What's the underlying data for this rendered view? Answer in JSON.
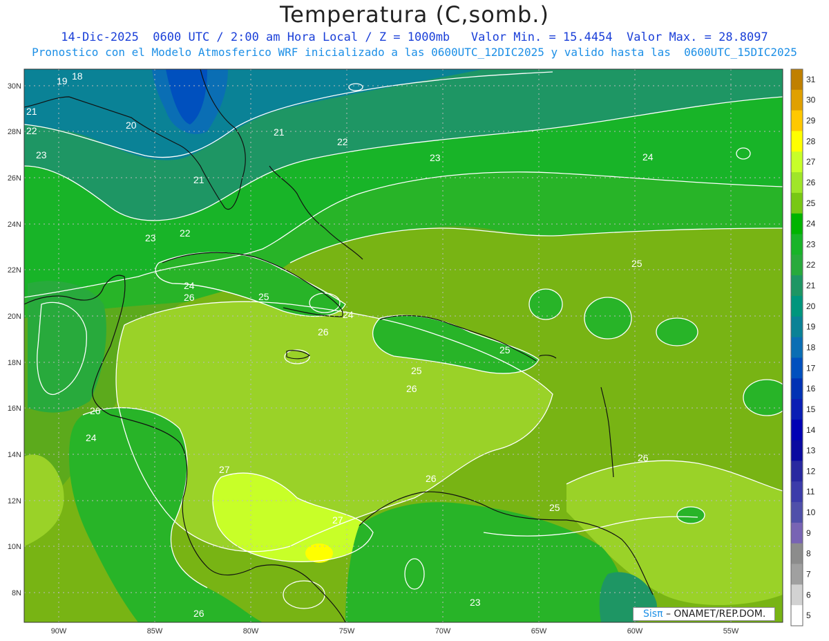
{
  "title": "Temperatura (C,somb.)",
  "subtitle_line1": "14-Dic-2025  0600 UTC / 2:00 am Hora Local / Z = 1000mb   Valor Min. = 15.4454  Valor Max. = 28.8097",
  "subtitle_line2": "Pronostico con el Modelo Atmosferico WRF inicializado a las 0600UTC_12DIC2025 y valido hasta las  0600UTC_15DIC2025",
  "lat_labels": [
    "30N",
    "28N",
    "26N",
    "24N",
    "22N",
    "20N",
    "18N",
    "16N",
    "14N",
    "12N",
    "10N",
    "8N"
  ],
  "lon_labels": [
    "90W",
    "85W",
    "80W",
    "75W",
    "70W",
    "65W",
    "60W",
    "55W"
  ],
  "colorbar": {
    "levels": [
      "31",
      "30",
      "29",
      "28",
      "27",
      "26",
      "25",
      "24",
      "23",
      "22",
      "21",
      "20",
      "19",
      "18",
      "17",
      "16",
      "15",
      "14",
      "13",
      "12",
      "11",
      "10",
      "9",
      "8",
      "7",
      "6",
      "5"
    ],
    "colors": [
      "#c08000",
      "#e0a000",
      "#ffc800",
      "#ffff00",
      "#c8ff28",
      "#a0e628",
      "#78c814",
      "#00b400",
      "#18b428",
      "#28aa3c",
      "#1e9664",
      "#00967d",
      "#0a8296",
      "#0a6eb4",
      "#0050be",
      "#0032b4",
      "#0a1eb4",
      "#0000b4",
      "#0a0aa0",
      "#2828a0",
      "#3c3caa",
      "#5050aa",
      "#7864b4",
      "#8c8c8c",
      "#a0a0a0",
      "#d2d2d2",
      "#ffffff"
    ]
  },
  "contour_labels": [
    "18",
    "19",
    "20",
    "21",
    "21",
    "21",
    "22",
    "22",
    "22",
    "23",
    "23",
    "23",
    "24",
    "24",
    "24",
    "24",
    "25",
    "25",
    "25",
    "25",
    "25",
    "26",
    "26",
    "26",
    "26",
    "26",
    "26",
    "27",
    "27",
    "23",
    "26"
  ],
  "credit": {
    "sis": "Sisπ",
    "rest": "– ONAMET/REP.DOM."
  }
}
